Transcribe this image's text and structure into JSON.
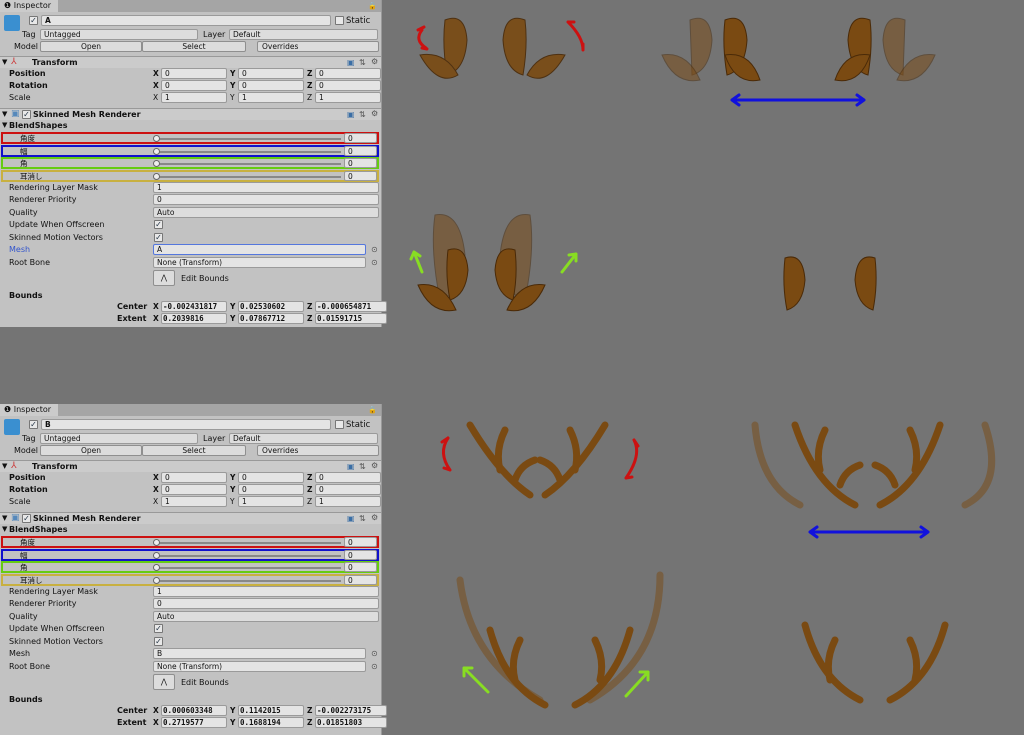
{
  "inspectors": [
    {
      "tab": "Inspector",
      "name": "A",
      "static_label": "Static",
      "tag_label": "Tag",
      "tag": "Untagged",
      "layer_label": "Layer",
      "layer": "Default",
      "model_label": "Model",
      "open": "Open",
      "select": "Select",
      "overrides": "Overrides",
      "transform": {
        "title": "Transform",
        "position": [
          "0",
          "0",
          "0"
        ],
        "rotation": [
          "0",
          "0",
          "0"
        ],
        "scale": [
          "1",
          "1",
          "1"
        ]
      },
      "smr": {
        "title": "Skinned Mesh Renderer",
        "blendshapes_title": "BlendShapes",
        "blendshapes": [
          {
            "name": "角度",
            "value": "0",
            "color": "#cc1111"
          },
          {
            "name": "幅",
            "value": "0",
            "color": "#1111cc"
          },
          {
            "name": "角",
            "value": "0",
            "color": "#66cc11"
          },
          {
            "name": "耳消し",
            "value": "0",
            "color": "#c8b040"
          }
        ],
        "rendering_layer_mask": "1",
        "renderer_priority": "0",
        "quality": "Auto",
        "update_when_offscreen": true,
        "skinned_motion_vectors": true,
        "mesh": "A",
        "root_bone": "None (Transform)",
        "edit_bounds": "Edit Bounds",
        "center": [
          "-0.002431817",
          "0.02530602",
          "-0.000654871"
        ],
        "extent": [
          "0.2039816",
          "0.07867712",
          "0.01591715"
        ]
      }
    },
    {
      "tab": "Inspector",
      "name": "B",
      "static_label": "Static",
      "tag_label": "Tag",
      "tag": "Untagged",
      "layer_label": "Layer",
      "layer": "Default",
      "model_label": "Model",
      "open": "Open",
      "select": "Select",
      "overrides": "Overrides",
      "transform": {
        "title": "Transform",
        "position": [
          "0",
          "0",
          "0"
        ],
        "rotation": [
          "0",
          "0",
          "0"
        ],
        "scale": [
          "1",
          "1",
          "1"
        ]
      },
      "smr": {
        "title": "Skinned Mesh Renderer",
        "blendshapes_title": "BlendShapes",
        "blendshapes": [
          {
            "name": "角度",
            "value": "0",
            "color": "#cc1111"
          },
          {
            "name": "幅",
            "value": "0",
            "color": "#1111cc"
          },
          {
            "name": "角",
            "value": "0",
            "color": "#66cc11"
          },
          {
            "name": "耳消し",
            "value": "0",
            "color": "#c8b040"
          }
        ],
        "rendering_layer_mask": "1",
        "renderer_priority": "0",
        "quality": "Auto",
        "update_when_offscreen": true,
        "skinned_motion_vectors": true,
        "mesh": "B",
        "root_bone": "None (Transform)",
        "edit_bounds": "Edit Bounds",
        "center": [
          "0.000603348",
          "0.1142015",
          "-0.002273175"
        ],
        "extent": [
          "0.2719577",
          "0.1688194",
          "0.01851803"
        ]
      }
    }
  ],
  "labels": {
    "position": "Position",
    "rotation": "Rotation",
    "scale": "Scale",
    "rendering_layer_mask": "Rendering Layer Mask",
    "renderer_priority": "Renderer Priority",
    "quality": "Quality",
    "update_when_offscreen": "Update When Offscreen",
    "skinned_motion_vectors": "Skinned Motion Vectors",
    "mesh": "Mesh",
    "root_bone": "Root Bone",
    "bounds": "Bounds",
    "center": "Center",
    "extent": "Extent"
  },
  "colors": {
    "antler": "#7a4a12",
    "rotate_arrow": "#cc1111",
    "width_arrow": "#1111dd",
    "horn_arrow": "#88dd22"
  }
}
